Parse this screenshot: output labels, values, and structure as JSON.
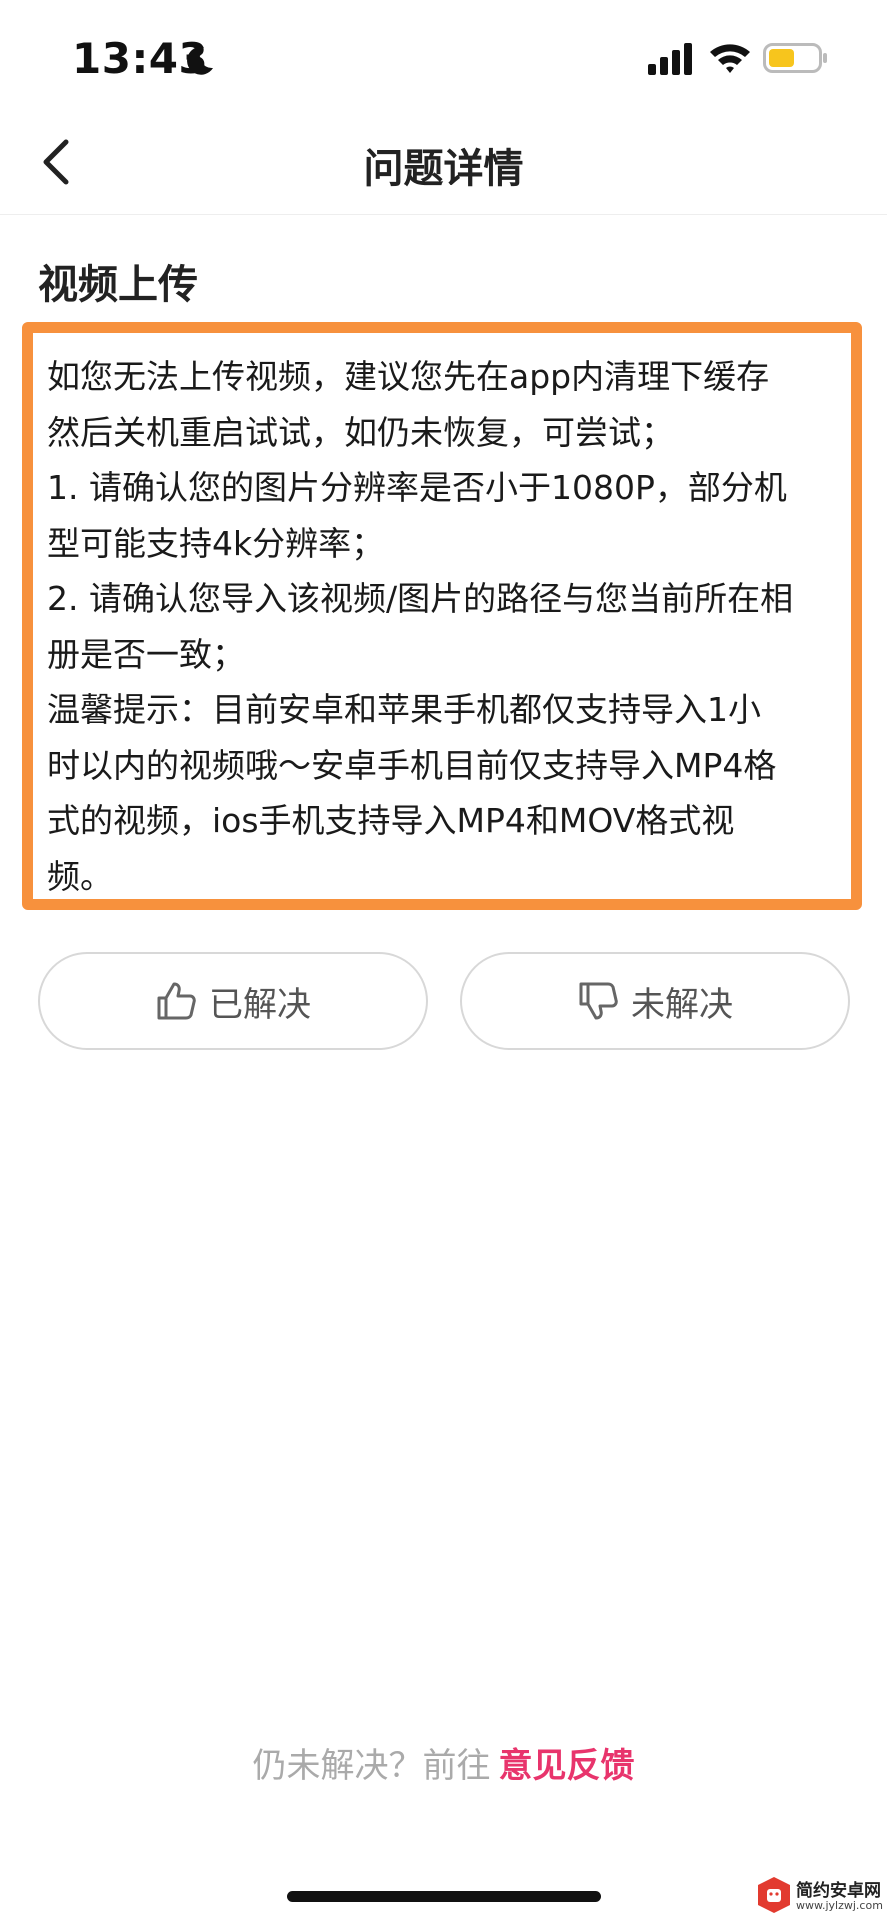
{
  "status_bar": {
    "time": "13:43",
    "icons": [
      "moon-icon",
      "signal-icon",
      "wifi-icon",
      "battery-icon"
    ],
    "battery_color": "#f7c51d"
  },
  "nav": {
    "back_icon": "chevron-left-icon",
    "title": "问题详情"
  },
  "section": {
    "title": "视频上传"
  },
  "answer": {
    "highlight_color": "#f7913d",
    "lines": [
      "如您无法上传视频，建议您先在app内清理下缓存",
      "然后关机重启试试，如仍未恢复，可尝试；",
      "1. 请确认您的图片分辨率是否小于1080P，部分机",
      "型可能支持4k分辨率；",
      "2. 请确认您导入该视频/图片的路径与您当前所在相",
      "册是否一致；",
      "温馨提示：目前安卓和苹果手机都仅支持导入1小",
      "时以内的视频哦～安卓手机目前仅支持导入MP4格",
      "式的视频，ios手机支持导入MP4和MOV格式视",
      "频。"
    ]
  },
  "votes": {
    "resolved_label": "已解决",
    "resolved_icon": "thumbs-up-icon",
    "unresolved_label": "未解决",
    "unresolved_icon": "thumbs-down-icon"
  },
  "footer": {
    "prefix": "仍未解决？前往",
    "link_label": "意见反馈",
    "link_color": "#e8346c"
  },
  "watermark": {
    "name": "简约安卓网",
    "url": "www.jylzwj.com"
  }
}
